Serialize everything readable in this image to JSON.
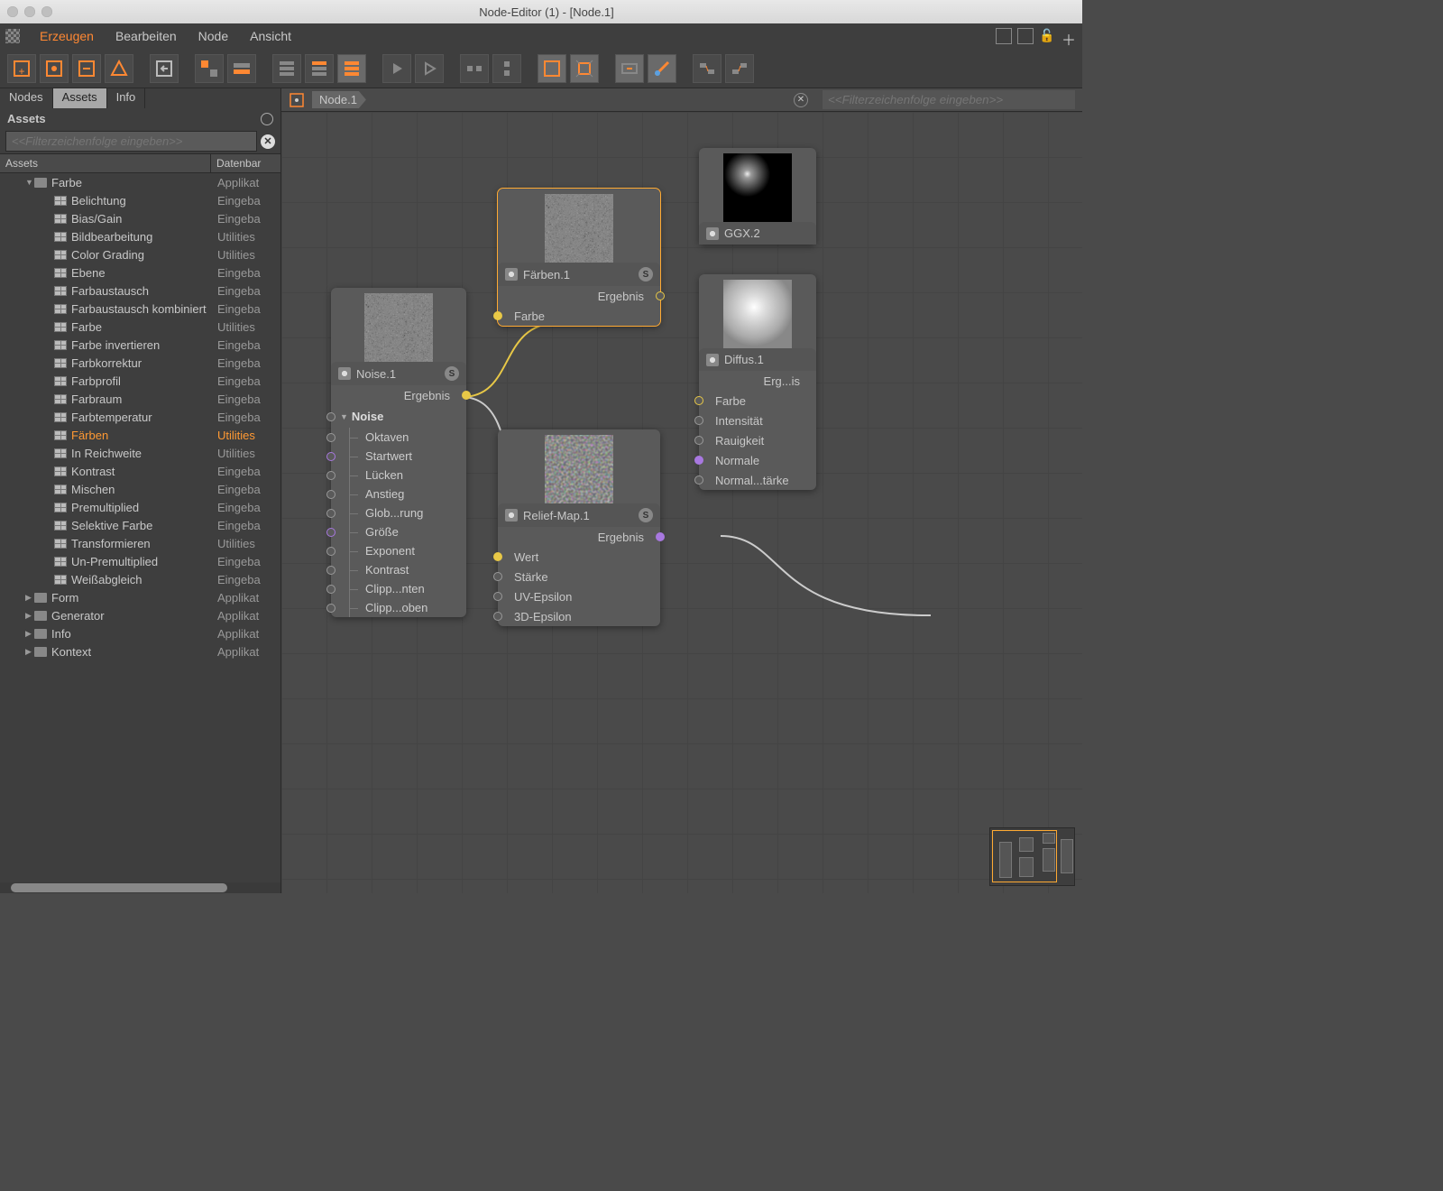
{
  "window": {
    "title": "Node-Editor (1) - [Node.1]"
  },
  "menu": {
    "items": [
      "Erzeugen",
      "Bearbeiten",
      "Node",
      "Ansicht"
    ]
  },
  "sidebarTabs": [
    "Nodes",
    "Assets",
    "Info"
  ],
  "sidebar": {
    "title": "Assets",
    "filter_placeholder": "<<Filterzeichenfolge eingeben>>",
    "col1": "Assets",
    "col2": "Datenbar"
  },
  "tree": [
    {
      "lvl": 1,
      "type": "folder",
      "exp": true,
      "label": "Farbe",
      "db": "Applikat"
    },
    {
      "lvl": 2,
      "type": "item",
      "label": "Belichtung",
      "db": "Eingeba"
    },
    {
      "lvl": 2,
      "type": "item",
      "label": "Bias/Gain",
      "db": "Eingeba"
    },
    {
      "lvl": 2,
      "type": "item",
      "label": "Bildbearbeitung",
      "db": "Utilities"
    },
    {
      "lvl": 2,
      "type": "item",
      "label": "Color Grading",
      "db": "Utilities"
    },
    {
      "lvl": 2,
      "type": "item",
      "label": "Ebene",
      "db": "Eingeba"
    },
    {
      "lvl": 2,
      "type": "item",
      "label": "Farbaustausch",
      "db": "Eingeba"
    },
    {
      "lvl": 2,
      "type": "item",
      "label": "Farbaustausch kombiniert",
      "db": "Eingeba"
    },
    {
      "lvl": 2,
      "type": "item",
      "label": "Farbe",
      "db": "Utilities"
    },
    {
      "lvl": 2,
      "type": "item",
      "label": "Farbe invertieren",
      "db": "Eingeba"
    },
    {
      "lvl": 2,
      "type": "item",
      "label": "Farbkorrektur",
      "db": "Eingeba"
    },
    {
      "lvl": 2,
      "type": "item",
      "label": "Farbprofil",
      "db": "Eingeba"
    },
    {
      "lvl": 2,
      "type": "item",
      "label": "Farbraum",
      "db": "Eingeba"
    },
    {
      "lvl": 2,
      "type": "item",
      "label": "Farbtemperatur",
      "db": "Eingeba"
    },
    {
      "lvl": 2,
      "type": "item",
      "label": "Färben",
      "db": "Utilities",
      "sel": true
    },
    {
      "lvl": 2,
      "type": "item",
      "label": "In Reichweite",
      "db": "Utilities"
    },
    {
      "lvl": 2,
      "type": "item",
      "label": "Kontrast",
      "db": "Eingeba"
    },
    {
      "lvl": 2,
      "type": "item",
      "label": "Mischen",
      "db": "Eingeba"
    },
    {
      "lvl": 2,
      "type": "item",
      "label": "Premultiplied",
      "db": "Eingeba"
    },
    {
      "lvl": 2,
      "type": "item",
      "label": "Selektive Farbe",
      "db": "Eingeba"
    },
    {
      "lvl": 2,
      "type": "item",
      "label": "Transformieren",
      "db": "Utilities"
    },
    {
      "lvl": 2,
      "type": "item",
      "label": "Un-Premultiplied",
      "db": "Eingeba"
    },
    {
      "lvl": 2,
      "type": "item",
      "label": "Weißabgleich",
      "db": "Eingeba"
    },
    {
      "lvl": 1,
      "type": "folder",
      "exp": false,
      "label": "Form",
      "db": "Applikat"
    },
    {
      "lvl": 1,
      "type": "folder",
      "exp": false,
      "label": "Generator",
      "db": "Applikat"
    },
    {
      "lvl": 1,
      "type": "folder",
      "exp": false,
      "label": "Info",
      "db": "Applikat"
    },
    {
      "lvl": 1,
      "type": "folder",
      "exp": false,
      "label": "Kontext",
      "db": "Applikat"
    }
  ],
  "crumb": {
    "node": "Node.1",
    "filter_placeholder": "<<Filterzeichenfolge eingeben>>"
  },
  "nodes": {
    "noise": {
      "title": "Noise.1",
      "out": "Ergebnis",
      "section": "Noise",
      "params": [
        "Oktaven",
        "Startwert",
        "Lücken",
        "Anstieg",
        "Glob...rung",
        "Größe",
        "Exponent",
        "Kontrast",
        "Clipp...nten",
        "Clipp...oben"
      ]
    },
    "faerben": {
      "title": "Färben.1",
      "out": "Ergebnis",
      "in": "Farbe"
    },
    "relief": {
      "title": "Relief-Map.1",
      "out": "Ergebnis",
      "ins": [
        "Wert",
        "Stärke",
        "UV-Epsilon",
        "3D-Epsilon"
      ]
    },
    "ggx": {
      "title": "GGX.2"
    },
    "diffus": {
      "title": "Diffus.1",
      "out": "Erg...is",
      "ins": [
        "Farbe",
        "Intensität",
        "Rauigkeit",
        "Normale",
        "Normal...tärke"
      ]
    }
  }
}
